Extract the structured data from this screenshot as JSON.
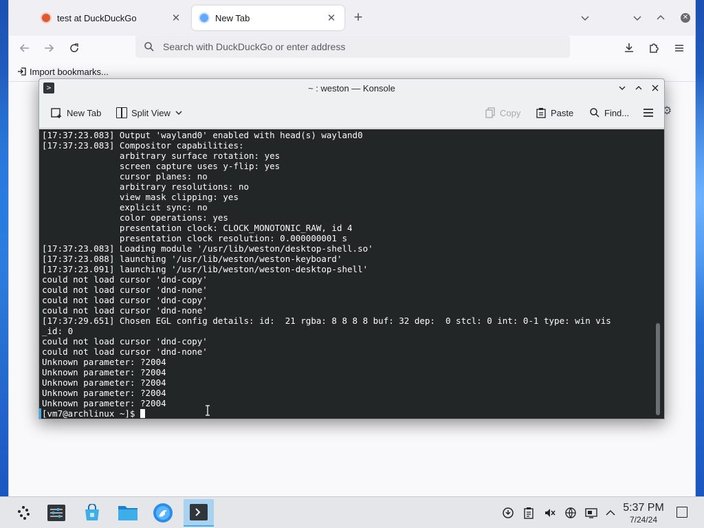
{
  "browser": {
    "tabs": [
      {
        "title": "test at DuckDuckGo",
        "icon": "duckduckgo-icon",
        "active": false
      },
      {
        "title": "New Tab",
        "icon": "firefox-icon",
        "active": true
      }
    ],
    "urlbar_placeholder": "Search with DuckDuckGo or enter address",
    "bookmark_import_label": "Import bookmarks..."
  },
  "konsole": {
    "window_title": "~ : weston — Konsole",
    "toolbar": {
      "new_tab": "New Tab",
      "split_view": "Split View",
      "copy": "Copy",
      "paste": "Paste",
      "find": "Find..."
    },
    "terminal_lines": [
      "[17:37:23.083] Output 'wayland0' enabled with head(s) wayland0",
      "[17:37:23.083] Compositor capabilities:",
      "               arbitrary surface rotation: yes",
      "               screen capture uses y-flip: yes",
      "               cursor planes: no",
      "               arbitrary resolutions: no",
      "               view mask clipping: yes",
      "               explicit sync: no",
      "               color operations: yes",
      "               presentation clock: CLOCK_MONOTONIC_RAW, id 4",
      "               presentation clock resolution: 0.000000001 s",
      "[17:37:23.083] Loading module '/usr/lib/weston/desktop-shell.so'",
      "[17:37:23.088] launching '/usr/lib/weston/weston-keyboard'",
      "[17:37:23.091] launching '/usr/lib/weston/weston-desktop-shell'",
      "could not load cursor 'dnd-copy'",
      "could not load cursor 'dnd-none'",
      "could not load cursor 'dnd-copy'",
      "could not load cursor 'dnd-none'",
      "[17:37:29.651] Chosen EGL config details: id:  21 rgba: 8 8 8 8 buf: 32 dep:  0 stcl: 0 int: 0-1 type: win vis",
      "_id: 0",
      "could not load cursor 'dnd-copy'",
      "could not load cursor 'dnd-none'",
      "Unknown parameter: ?2004",
      "Unknown parameter: ?2004",
      "Unknown parameter: ?2004",
      "Unknown parameter: ?2004",
      "Unknown parameter: ?2004"
    ],
    "prompt": "[vm7@archlinux ~]$ "
  },
  "taskbar": {
    "apps": [
      {
        "name": "application-launcher",
        "active": false
      },
      {
        "name": "system-settings",
        "active": false
      },
      {
        "name": "discover",
        "active": false
      },
      {
        "name": "dolphin-files",
        "active": false
      },
      {
        "name": "firefox",
        "active": false
      },
      {
        "name": "konsole",
        "active": true
      }
    ],
    "clock": {
      "time": "5:37 PM",
      "date": "7/24/24"
    }
  },
  "colors": {
    "terminal_bg": "#232627",
    "terminal_fg": "#fcfcfc",
    "accent": "#3daee9",
    "panel_bg": "#e4e6e9"
  }
}
